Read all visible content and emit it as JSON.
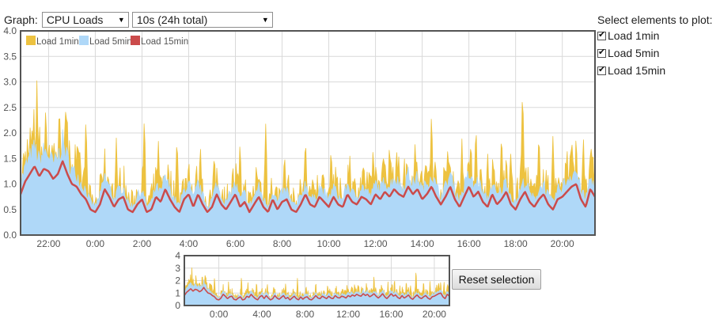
{
  "controls": {
    "graph_label": "Graph:",
    "graph_select": "CPU Loads",
    "range_select": "10s (24h total)"
  },
  "element_panel": {
    "title": "Select elements to plot:",
    "items": [
      {
        "label": "Load 1min",
        "checked": true
      },
      {
        "label": "Load 5min",
        "checked": true
      },
      {
        "label": "Load 15min",
        "checked": true
      }
    ]
  },
  "reset_button": "Reset selection",
  "colors": {
    "load1": "#EDC240",
    "load5": "#AFD8F8",
    "load15": "#CB4B4B",
    "grid": "#d9d9d9",
    "axis_text": "#545454"
  },
  "chart_data": [
    {
      "type": "area",
      "name": "main",
      "y_ticks": [
        "0.0",
        "0.5",
        "1.0",
        "1.5",
        "2.0",
        "2.5",
        "3.0",
        "3.5",
        "4.0"
      ],
      "ylim": [
        0,
        4
      ],
      "x_range_hours": [
        20.8,
        45.4
      ],
      "x_ticks": [
        {
          "label": "22:00",
          "h": 22
        },
        {
          "label": "0:00",
          "h": 24
        },
        {
          "label": "2:00",
          "h": 26
        },
        {
          "label": "4:00",
          "h": 28
        },
        {
          "label": "6:00",
          "h": 30
        },
        {
          "label": "8:00",
          "h": 32
        },
        {
          "label": "10:00",
          "h": 34
        },
        {
          "label": "12:00",
          "h": 36
        },
        {
          "label": "14:00",
          "h": 38
        },
        {
          "label": "16:00",
          "h": 40
        },
        {
          "label": "18:00",
          "h": 42
        },
        {
          "label": "20:00",
          "h": 44
        }
      ],
      "legend": [
        "Load 1min",
        "Load 5min",
        "Load 15min"
      ],
      "grid": true,
      "series_load15": [
        {
          "h": 20.8,
          "v": 0.8
        },
        {
          "h": 21.0,
          "v": 1.05
        },
        {
          "h": 21.2,
          "v": 1.2
        },
        {
          "h": 21.4,
          "v": 1.35
        },
        {
          "h": 21.6,
          "v": 1.15
        },
        {
          "h": 21.8,
          "v": 1.3
        },
        {
          "h": 22.0,
          "v": 1.25
        },
        {
          "h": 22.2,
          "v": 1.1
        },
        {
          "h": 22.4,
          "v": 1.2
        },
        {
          "h": 22.6,
          "v": 1.45
        },
        {
          "h": 22.8,
          "v": 1.2
        },
        {
          "h": 23.0,
          "v": 1.0
        },
        {
          "h": 23.2,
          "v": 0.95
        },
        {
          "h": 23.4,
          "v": 0.8
        },
        {
          "h": 23.6,
          "v": 0.7
        },
        {
          "h": 23.8,
          "v": 0.5
        },
        {
          "h": 24.0,
          "v": 0.45
        },
        {
          "h": 24.2,
          "v": 0.6
        },
        {
          "h": 24.4,
          "v": 0.9
        },
        {
          "h": 24.6,
          "v": 0.75
        },
        {
          "h": 24.8,
          "v": 0.55
        },
        {
          "h": 25.0,
          "v": 0.7
        },
        {
          "h": 25.2,
          "v": 0.75
        },
        {
          "h": 25.4,
          "v": 0.5
        },
        {
          "h": 25.6,
          "v": 0.45
        },
        {
          "h": 25.8,
          "v": 0.6
        },
        {
          "h": 26.0,
          "v": 0.7
        },
        {
          "h": 26.2,
          "v": 0.45
        },
        {
          "h": 26.4,
          "v": 0.5
        },
        {
          "h": 26.6,
          "v": 0.75
        },
        {
          "h": 26.8,
          "v": 0.65
        },
        {
          "h": 27.0,
          "v": 0.9
        },
        {
          "h": 27.2,
          "v": 0.7
        },
        {
          "h": 27.4,
          "v": 0.55
        },
        {
          "h": 27.6,
          "v": 0.45
        },
        {
          "h": 27.8,
          "v": 0.7
        },
        {
          "h": 28.0,
          "v": 0.8
        },
        {
          "h": 28.2,
          "v": 0.55
        },
        {
          "h": 28.4,
          "v": 0.8
        },
        {
          "h": 28.6,
          "v": 0.6
        },
        {
          "h": 28.8,
          "v": 0.45
        },
        {
          "h": 29.0,
          "v": 0.55
        },
        {
          "h": 29.2,
          "v": 0.8
        },
        {
          "h": 29.4,
          "v": 0.6
        },
        {
          "h": 29.6,
          "v": 0.5
        },
        {
          "h": 29.8,
          "v": 0.65
        },
        {
          "h": 30.0,
          "v": 0.8
        },
        {
          "h": 30.2,
          "v": 0.55
        },
        {
          "h": 30.4,
          "v": 0.65
        },
        {
          "h": 30.6,
          "v": 0.45
        },
        {
          "h": 30.8,
          "v": 0.6
        },
        {
          "h": 31.0,
          "v": 0.75
        },
        {
          "h": 31.2,
          "v": 0.55
        },
        {
          "h": 31.4,
          "v": 0.45
        },
        {
          "h": 31.6,
          "v": 0.7
        },
        {
          "h": 31.8,
          "v": 0.5
        },
        {
          "h": 32.0,
          "v": 0.65
        },
        {
          "h": 32.2,
          "v": 0.7
        },
        {
          "h": 32.4,
          "v": 0.5
        },
        {
          "h": 32.6,
          "v": 0.45
        },
        {
          "h": 32.8,
          "v": 0.6
        },
        {
          "h": 33.0,
          "v": 0.8
        },
        {
          "h": 33.2,
          "v": 0.6
        },
        {
          "h": 33.4,
          "v": 0.55
        },
        {
          "h": 33.6,
          "v": 0.75
        },
        {
          "h": 33.8,
          "v": 0.65
        },
        {
          "h": 34.0,
          "v": 0.55
        },
        {
          "h": 34.2,
          "v": 0.75
        },
        {
          "h": 34.4,
          "v": 0.6
        },
        {
          "h": 34.6,
          "v": 0.55
        },
        {
          "h": 34.8,
          "v": 0.8
        },
        {
          "h": 35.0,
          "v": 0.65
        },
        {
          "h": 35.2,
          "v": 0.6
        },
        {
          "h": 35.4,
          "v": 0.75
        },
        {
          "h": 35.6,
          "v": 0.7
        },
        {
          "h": 35.8,
          "v": 0.6
        },
        {
          "h": 36.0,
          "v": 0.8
        },
        {
          "h": 36.2,
          "v": 0.7
        },
        {
          "h": 36.4,
          "v": 0.85
        },
        {
          "h": 36.6,
          "v": 0.75
        },
        {
          "h": 36.8,
          "v": 0.9
        },
        {
          "h": 37.0,
          "v": 0.8
        },
        {
          "h": 37.2,
          "v": 0.75
        },
        {
          "h": 37.4,
          "v": 0.95
        },
        {
          "h": 37.6,
          "v": 0.8
        },
        {
          "h": 37.8,
          "v": 0.9
        },
        {
          "h": 38.0,
          "v": 0.7
        },
        {
          "h": 38.2,
          "v": 0.8
        },
        {
          "h": 38.4,
          "v": 0.95
        },
        {
          "h": 38.6,
          "v": 0.75
        },
        {
          "h": 38.8,
          "v": 0.6
        },
        {
          "h": 39.0,
          "v": 0.75
        },
        {
          "h": 39.2,
          "v": 0.95
        },
        {
          "h": 39.4,
          "v": 0.7
        },
        {
          "h": 39.6,
          "v": 0.55
        },
        {
          "h": 39.8,
          "v": 0.75
        },
        {
          "h": 40.0,
          "v": 0.95
        },
        {
          "h": 40.2,
          "v": 0.75
        },
        {
          "h": 40.4,
          "v": 0.85
        },
        {
          "h": 40.6,
          "v": 0.65
        },
        {
          "h": 40.8,
          "v": 0.55
        },
        {
          "h": 41.0,
          "v": 0.8
        },
        {
          "h": 41.2,
          "v": 0.6
        },
        {
          "h": 41.4,
          "v": 0.7
        },
        {
          "h": 41.6,
          "v": 0.85
        },
        {
          "h": 41.8,
          "v": 0.6
        },
        {
          "h": 42.0,
          "v": 0.5
        },
        {
          "h": 42.2,
          "v": 0.7
        },
        {
          "h": 42.4,
          "v": 0.85
        },
        {
          "h": 42.6,
          "v": 0.65
        },
        {
          "h": 42.8,
          "v": 0.55
        },
        {
          "h": 43.0,
          "v": 0.7
        },
        {
          "h": 43.2,
          "v": 0.8
        },
        {
          "h": 43.4,
          "v": 0.6
        },
        {
          "h": 43.6,
          "v": 0.5
        },
        {
          "h": 43.8,
          "v": 0.7
        },
        {
          "h": 44.0,
          "v": 0.75
        },
        {
          "h": 44.2,
          "v": 0.85
        },
        {
          "h": 44.4,
          "v": 0.95
        },
        {
          "h": 44.6,
          "v": 1.0
        },
        {
          "h": 44.8,
          "v": 0.7
        },
        {
          "h": 45.0,
          "v": 0.55
        },
        {
          "h": 45.2,
          "v": 0.9
        },
        {
          "h": 45.4,
          "v": 0.75
        }
      ],
      "load1_peaks": [
        {
          "h": 21.1,
          "v": 2.1
        },
        {
          "h": 21.5,
          "v": 3.1
        },
        {
          "h": 21.9,
          "v": 2.2
        },
        {
          "h": 22.3,
          "v": 1.9
        },
        {
          "h": 22.9,
          "v": 2.0
        },
        {
          "h": 23.6,
          "v": 2.4
        },
        {
          "h": 24.3,
          "v": 1.3
        },
        {
          "h": 24.9,
          "v": 1.9
        },
        {
          "h": 26.1,
          "v": 2.4
        },
        {
          "h": 26.7,
          "v": 1.9
        },
        {
          "h": 27.5,
          "v": 2.0
        },
        {
          "h": 28.0,
          "v": 1.6
        },
        {
          "h": 28.5,
          "v": 1.8
        },
        {
          "h": 29.1,
          "v": 1.7
        },
        {
          "h": 30.2,
          "v": 1.9
        },
        {
          "h": 30.9,
          "v": 1.5
        },
        {
          "h": 31.3,
          "v": 2.25
        },
        {
          "h": 32.1,
          "v": 1.7
        },
        {
          "h": 33.0,
          "v": 2.0
        },
        {
          "h": 34.1,
          "v": 1.8
        },
        {
          "h": 34.9,
          "v": 1.6
        },
        {
          "h": 35.5,
          "v": 1.5
        },
        {
          "h": 35.9,
          "v": 1.8
        },
        {
          "h": 36.6,
          "v": 1.9
        },
        {
          "h": 37.0,
          "v": 1.6
        },
        {
          "h": 37.7,
          "v": 1.9
        },
        {
          "h": 38.4,
          "v": 2.5
        },
        {
          "h": 39.1,
          "v": 1.85
        },
        {
          "h": 39.7,
          "v": 1.9
        },
        {
          "h": 40.3,
          "v": 2.25
        },
        {
          "h": 40.8,
          "v": 1.7
        },
        {
          "h": 41.4,
          "v": 2.1
        },
        {
          "h": 41.8,
          "v": 1.7
        },
        {
          "h": 42.3,
          "v": 3.0
        },
        {
          "h": 43.0,
          "v": 2.1
        },
        {
          "h": 43.6,
          "v": 2.0
        },
        {
          "h": 44.2,
          "v": 1.8
        },
        {
          "h": 44.9,
          "v": 2.0
        },
        {
          "h": 45.3,
          "v": 1.8
        }
      ]
    },
    {
      "type": "area",
      "name": "overview",
      "y_ticks": [
        "0",
        "1",
        "2",
        "3",
        "4"
      ],
      "ylim": [
        0,
        4
      ],
      "x_range_hours": [
        20.8,
        45.4
      ],
      "x_ticks": [
        {
          "label": "0:00",
          "h": 24
        },
        {
          "label": "4:00",
          "h": 28
        },
        {
          "label": "8:00",
          "h": 32
        },
        {
          "label": "12:00",
          "h": 36
        },
        {
          "label": "16:00",
          "h": 40
        },
        {
          "label": "20:00",
          "h": 44
        }
      ]
    }
  ]
}
